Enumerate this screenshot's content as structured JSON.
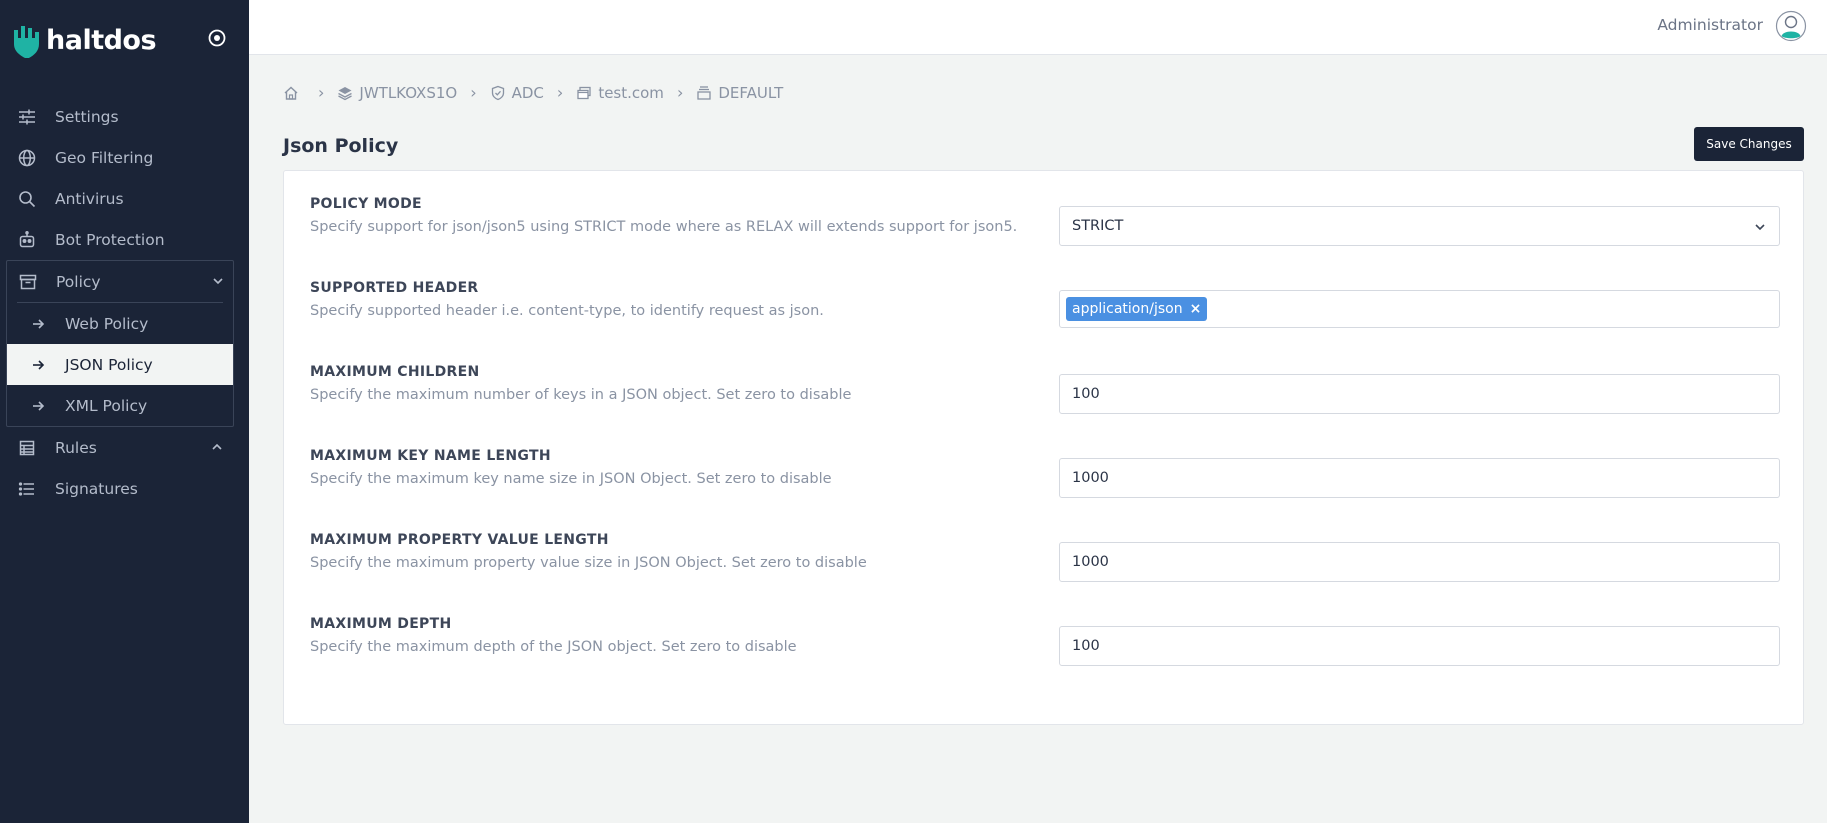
{
  "brand": {
    "name": "haltdos"
  },
  "sidebar": {
    "items": [
      {
        "label": "Settings",
        "icon": "sliders-icon"
      },
      {
        "label": "Geo Filtering",
        "icon": "globe-icon"
      },
      {
        "label": "Antivirus",
        "icon": "search-icon"
      },
      {
        "label": "Bot Protection",
        "icon": "robot-icon"
      }
    ],
    "policy_group": {
      "label": "Policy",
      "icon": "archive-icon",
      "children": [
        {
          "label": "Web Policy"
        },
        {
          "label": "JSON Policy",
          "active": true
        },
        {
          "label": "XML Policy"
        }
      ]
    },
    "after_items": [
      {
        "label": "Rules",
        "icon": "table-list-icon"
      },
      {
        "label": "Signatures",
        "icon": "list-icon"
      }
    ]
  },
  "header": {
    "user_name": "Administrator"
  },
  "breadcrumb": [
    {
      "label": "JWTLKOXS1O",
      "icon": "layers-icon"
    },
    {
      "label": "ADC",
      "icon": "shield-check-icon"
    },
    {
      "label": "test.com",
      "icon": "window-icon"
    },
    {
      "label": "DEFAULT",
      "icon": "stack-icon"
    }
  ],
  "page": {
    "title": "Json Policy",
    "save_label": "Save Changes"
  },
  "fields": {
    "policy_mode": {
      "label": "POLICY MODE",
      "description": "Specify support for json/json5 using STRICT mode where as RELAX will extends support for json5.",
      "value": "STRICT"
    },
    "supported_header": {
      "label": "SUPPORTED HEADER",
      "description": "Specify supported header i.e. content-type, to identify request as json.",
      "tags": [
        "application/json"
      ],
      "remove_glyph": "×"
    },
    "max_children": {
      "label": "MAXIMUM CHILDREN",
      "description": "Specify the maximum number of keys in a JSON object. Set zero to disable",
      "value": "100"
    },
    "max_key_name_length": {
      "label": "MAXIMUM KEY NAME LENGTH",
      "description": "Specify the maximum key name size in JSON Object. Set zero to disable",
      "value": "1000"
    },
    "max_property_value_length": {
      "label": "MAXIMUM PROPERTY VALUE LENGTH",
      "description": "Specify the maximum property value size in JSON Object. Set zero to disable",
      "value": "1000"
    },
    "max_depth": {
      "label": "MAXIMUM DEPTH",
      "description": "Specify the maximum depth of the JSON object. Set zero to disable",
      "value": "100"
    }
  },
  "colors": {
    "sidebar_bg": "#1b2437",
    "accent_teal": "#1fb3a4",
    "tag_blue": "#4a90e2"
  }
}
